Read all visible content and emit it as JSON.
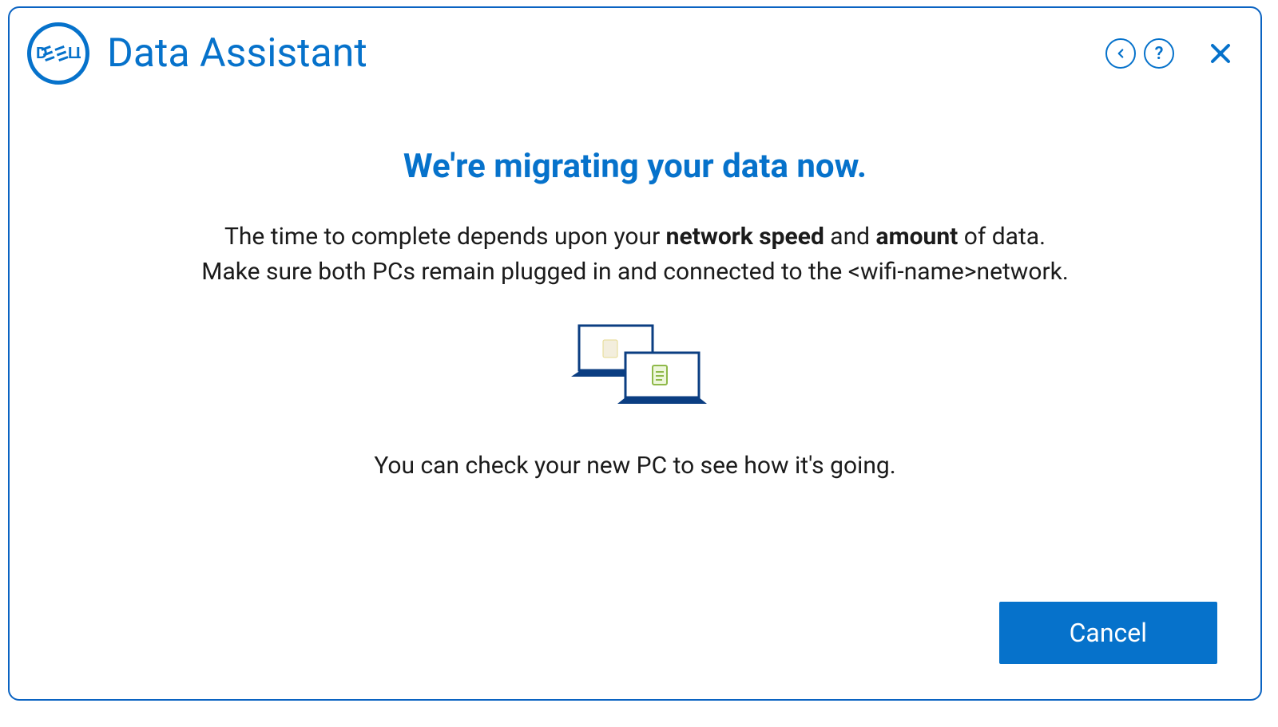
{
  "header": {
    "app_name": "Data Assistant",
    "logo_text": "DELL"
  },
  "main": {
    "headline": "We're migrating your data now.",
    "body_pre": "The time to complete depends upon your ",
    "body_bold1": "network speed",
    "body_mid": " and ",
    "body_bold2": "amount",
    "body_post": " of data.",
    "body_line2_pre": "Make sure both PCs remain plugged in and connected to the ",
    "wifi_placeholder": "<wifi-name>",
    "body_line2_post": "network.",
    "hint": "You can check your new PC to see how it's going."
  },
  "footer": {
    "cancel_label": "Cancel"
  },
  "colors": {
    "brand_blue": "#0672cb"
  }
}
